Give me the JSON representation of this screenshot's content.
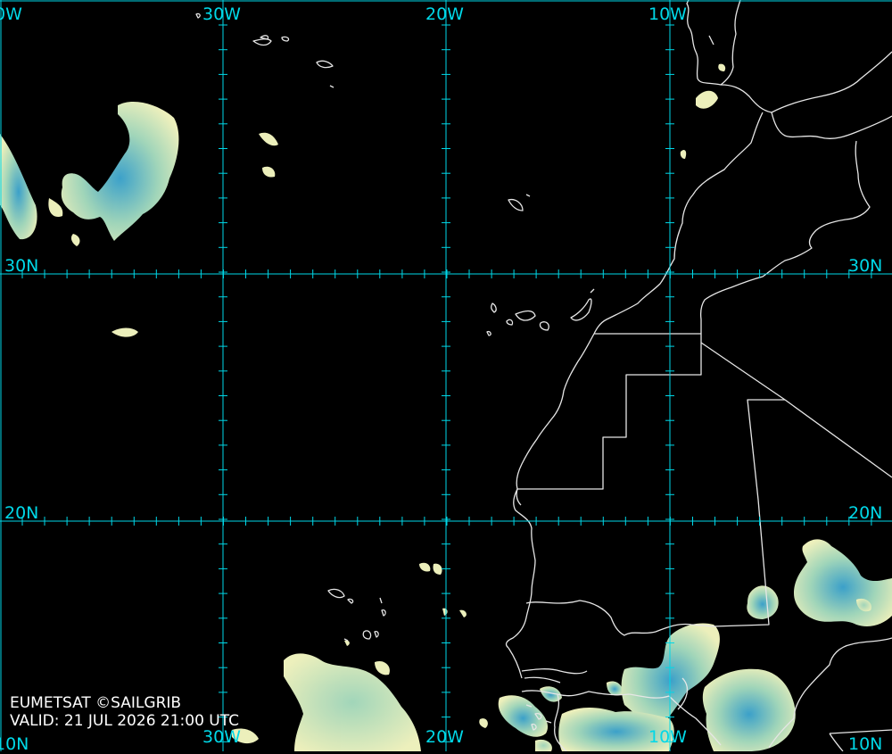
{
  "grid": {
    "lon_labels": {
      "w40": "0W",
      "w30": "30W",
      "w20": "20W",
      "w10": "10W"
    },
    "lat_labels": {
      "n30": "30N",
      "n20": "20N"
    },
    "bottom_labels": {
      "b40": "10N",
      "b30": "30W",
      "b20": "20W",
      "b10": "10W",
      "bright": "10N"
    },
    "color": "#00d8e8"
  },
  "credit": {
    "line1": "EUMETSAT ©SAILGRIB",
    "line2": "VALID:  21 JUL 2026 21:00 UTC"
  },
  "colors": {
    "background": "#000000",
    "coastline": "#e6e6e6",
    "cloud_light": "#f4f7c2",
    "cloud_mid": "#a6dcbf",
    "cloud_dark": "#3ea6d0"
  }
}
